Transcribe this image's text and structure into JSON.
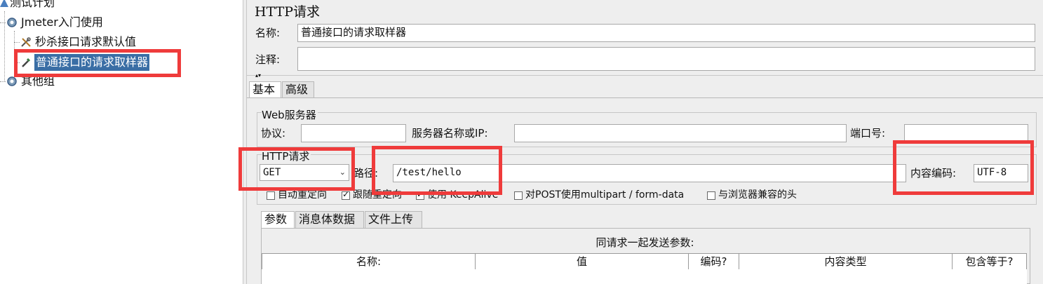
{
  "tree": {
    "root_label": "测试计划",
    "thread_group_label": "Jmeter入门使用",
    "config_label": "秒杀接口请求默认值",
    "sampler_label": "普通接口的请求取样器",
    "other_group_label": "其他组"
  },
  "panel": {
    "title": "HTTP请求",
    "name_label": "名称:",
    "name_value": "普通接口的请求取样器",
    "comment_label": "注释:",
    "comment_value": "",
    "tabs": [
      "基本",
      "高级"
    ],
    "web_server": {
      "group_label": "Web服务器",
      "protocol_label": "协议:",
      "protocol_value": "",
      "server_label": "服务器名称或IP:",
      "server_value": "",
      "port_label": "端口号:",
      "port_value": ""
    },
    "http_request": {
      "group_label": "HTTP请求",
      "method_value": "GET",
      "path_label": "路径:",
      "path_value": "/test/hello",
      "encoding_label": "内容编码:",
      "encoding_value": "UTF-8"
    },
    "options": [
      {
        "label": "自动重定向",
        "checked": false
      },
      {
        "label": "跟随重定向",
        "checked": true
      },
      {
        "label": "使用 KeepAlive",
        "checked": true
      },
      {
        "label": "对POST使用multipart / form-data",
        "checked": false
      },
      {
        "label": "与浏览器兼容的头",
        "checked": false
      }
    ],
    "sub_tabs": [
      "参数",
      "消息体数据",
      "文件上传"
    ],
    "params_caption": "同请求一起发送参数:",
    "columns": [
      "名称:",
      "值",
      "编码?",
      "内容类型",
      "包含等于?"
    ]
  },
  "colors": {
    "highlight": "#ef3b3b",
    "selection": "#3a6ea5",
    "panel_bg": "#eeeeee"
  }
}
